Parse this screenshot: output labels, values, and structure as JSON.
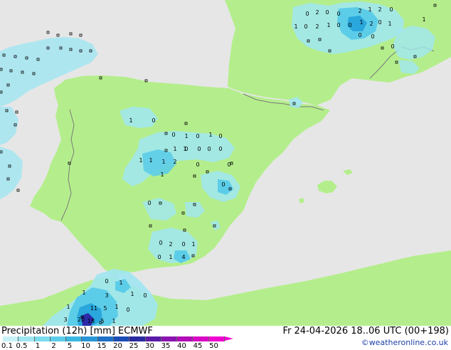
{
  "header": {
    "title": "Precipitation (12h) [mm] ECMWF",
    "datetime": "Fr 24-04-2026 18..06 UTC (00+198)",
    "credit": "©weatheronline.co.uk"
  },
  "colors": {
    "sea": "#e6e6e6",
    "land": "#b4ee8c",
    "border": "#7a7a7a",
    "precip_light": "#a0e6f2",
    "precip_mid": "#5ccde8",
    "precip_dark": "#2aa7dc",
    "precip_heavy": "#2b2aa8"
  },
  "legend": {
    "labels": [
      "0.1",
      "0.5",
      "1",
      "2",
      "5",
      "10",
      "15",
      "20",
      "25",
      "30",
      "35",
      "40",
      "45",
      "50"
    ],
    "colors": [
      "#c8f2f8",
      "#a0e6f2",
      "#7adcee",
      "#5ccde8",
      "#3ab8e2",
      "#2a96d8",
      "#2070c8",
      "#1c4cb6",
      "#2a2aa0",
      "#5a1ca8",
      "#8a14b0",
      "#b40cb8",
      "#d808c4",
      "#f004d0"
    ]
  },
  "map_labels": [
    {
      "t": "0"
    },
    {
      "t": "2"
    },
    {
      "t": "0"
    },
    {
      "t": "0"
    },
    {
      "t": "2"
    },
    {
      "t": "1"
    },
    {
      "t": "2"
    },
    {
      "t": "0"
    },
    {
      "t": "1"
    },
    {
      "t": "0"
    },
    {
      "t": "2"
    },
    {
      "t": "1"
    },
    {
      "t": "0"
    },
    {
      "t": "0"
    },
    {
      "t": "1"
    },
    {
      "t": "0"
    },
    {
      "t": "2"
    },
    {
      "t": "0"
    },
    {
      "t": "1"
    },
    {
      "t": "0"
    },
    {
      "t": "0"
    },
    {
      "t": "1"
    },
    {
      "t": "1"
    },
    {
      "t": "0"
    },
    {
      "t": "0"
    },
    {
      "t": "1"
    },
    {
      "t": "1"
    },
    {
      "t": "0"
    },
    {
      "t": "0"
    },
    {
      "t": "1"
    },
    {
      "t": "1"
    },
    {
      "t": "2"
    },
    {
      "t": "1"
    },
    {
      "t": "0"
    },
    {
      "t": "0"
    },
    {
      "t": "0"
    },
    {
      "t": "0"
    },
    {
      "t": "1"
    },
    {
      "t": "1"
    },
    {
      "t": "0"
    },
    {
      "t": "0"
    },
    {
      "t": "0"
    },
    {
      "t": "0"
    },
    {
      "t": "1"
    },
    {
      "t": "0"
    },
    {
      "t": "2"
    },
    {
      "t": "0"
    },
    {
      "t": "1"
    },
    {
      "t": "0"
    },
    {
      "t": "1"
    },
    {
      "t": "4"
    },
    {
      "t": "0"
    },
    {
      "t": "1"
    },
    {
      "t": "1"
    },
    {
      "t": "3"
    },
    {
      "t": "0"
    },
    {
      "t": "1"
    },
    {
      "t": "11"
    },
    {
      "t": "5"
    },
    {
      "t": "1"
    },
    {
      "t": "1"
    },
    {
      "t": "0"
    },
    {
      "t": "3"
    },
    {
      "t": "20"
    },
    {
      "t": "18"
    },
    {
      "t": "5"
    },
    {
      "t": "1"
    }
  ]
}
